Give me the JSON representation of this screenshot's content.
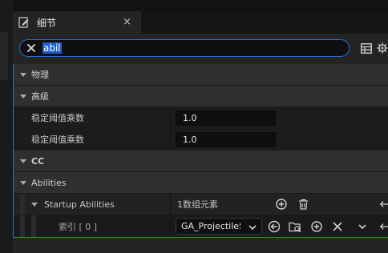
{
  "tab": {
    "title": "细节",
    "icon": "details-pencil-icon",
    "close_label": "×"
  },
  "search": {
    "value": "abil",
    "clear_icon": "clear-x-icon"
  },
  "toolbar": {
    "table_icon": "table-view-icon",
    "settings_icon": "gear-icon"
  },
  "rows": {
    "physics": {
      "label": "物理"
    },
    "advanced": {
      "label": "高级"
    },
    "stabilize_1": {
      "label": "稳定阈值乘数",
      "value": "1.0"
    },
    "stabilize_2": {
      "label": "稳定阈值乘数",
      "value": "1.0"
    },
    "cc": {
      "label": "CC"
    },
    "abilities": {
      "label": "Abilities"
    },
    "startup": {
      "label": "Startup Abilities",
      "value": "1数组元素"
    },
    "index": {
      "label": "索引 [ 0 ]",
      "value": "GA_ProjectileS"
    }
  },
  "colors": {
    "accent": "#2a6fd6",
    "panel": "#242424",
    "category": "#2f2f2f",
    "property": "#1c1c1c"
  }
}
